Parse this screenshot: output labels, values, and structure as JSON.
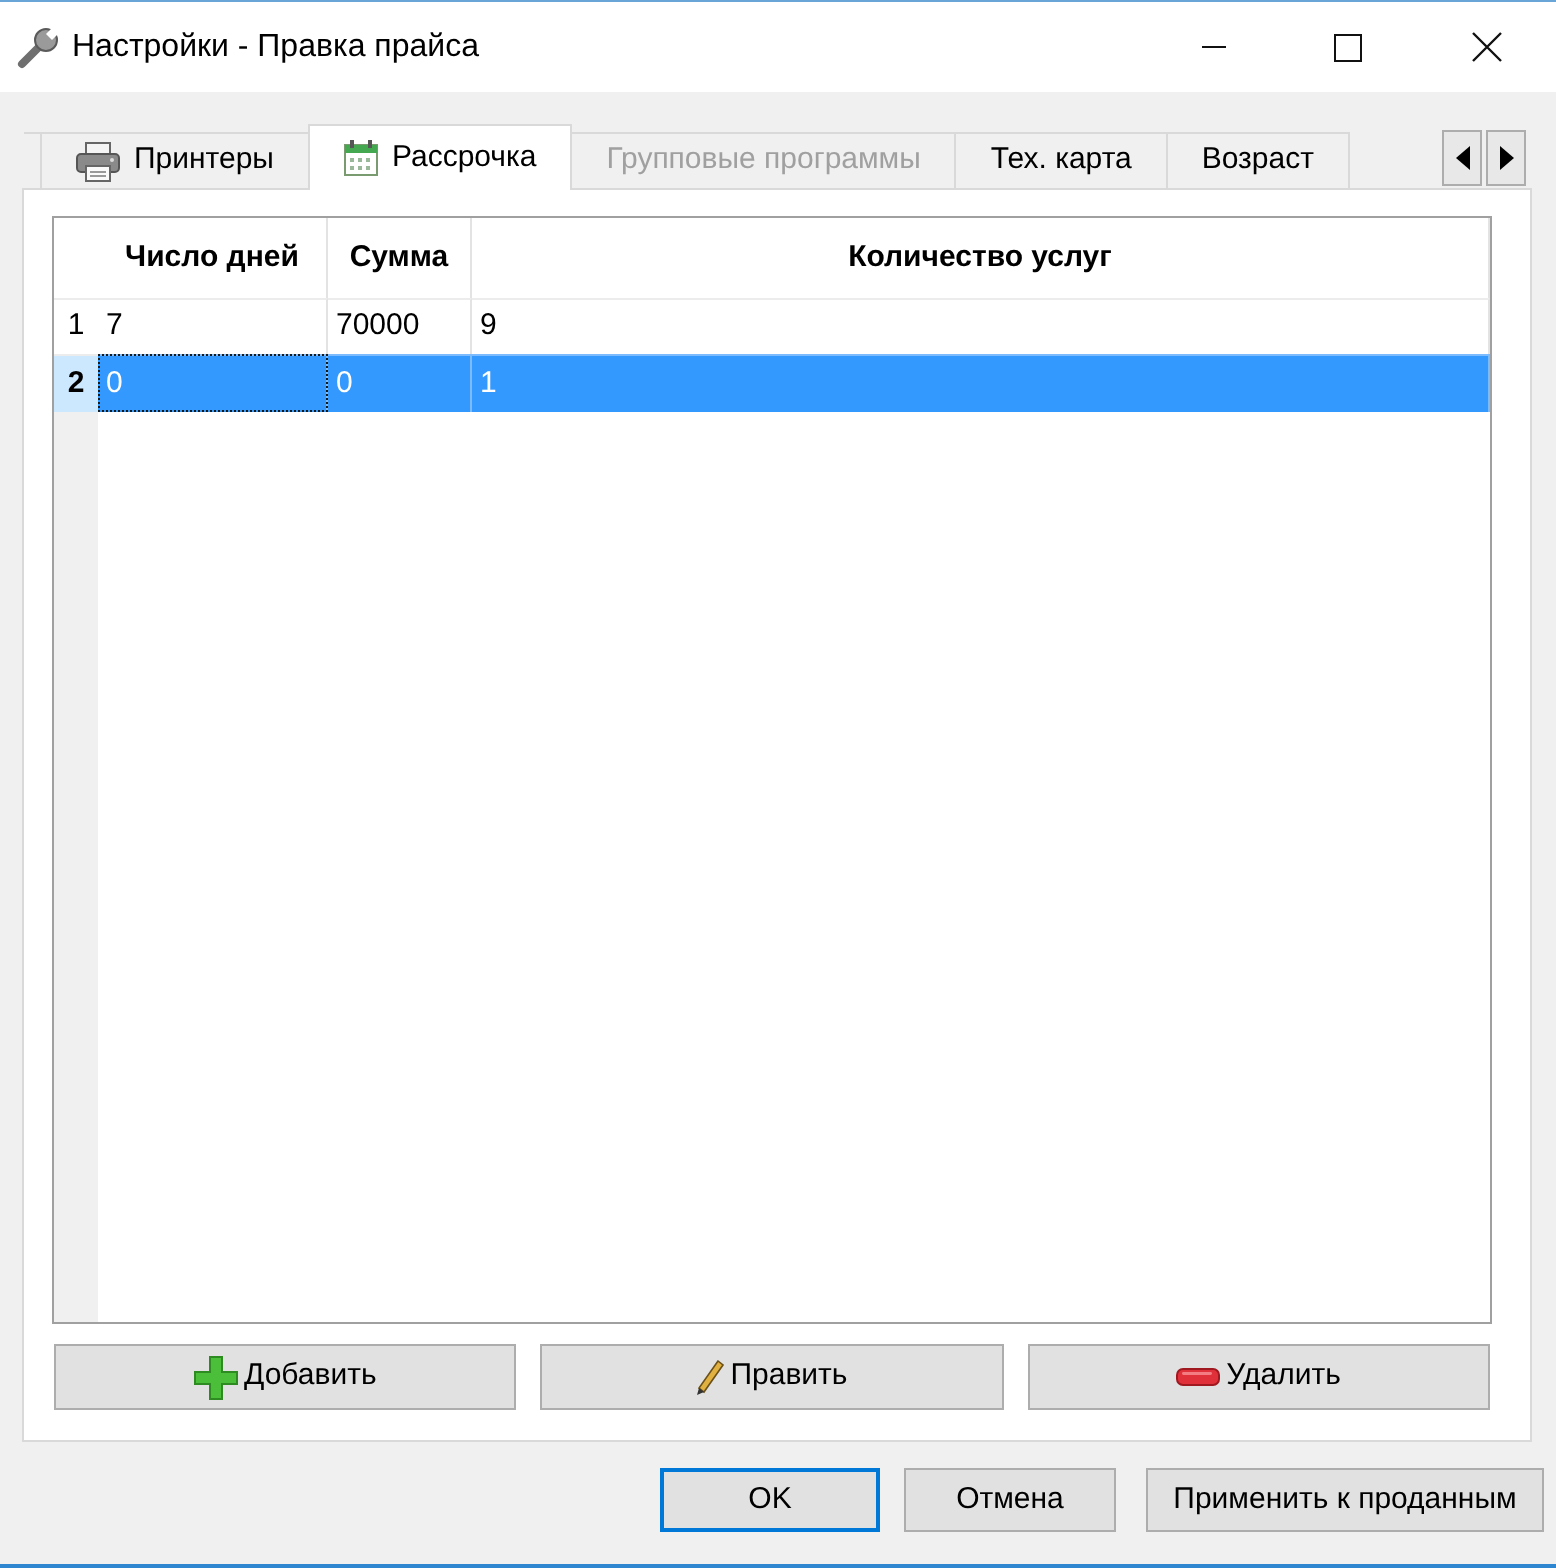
{
  "window": {
    "title": "Настройки - Правка прайса"
  },
  "tabs": [
    {
      "label": "Принтеры",
      "kind": "printer",
      "selected": false,
      "disabled": false
    },
    {
      "label": "Рассрочка",
      "kind": "calendar",
      "selected": true,
      "disabled": false
    },
    {
      "label": "Групповые программы",
      "kind": "plain",
      "selected": false,
      "disabled": true
    },
    {
      "label": "Тех. карта",
      "kind": "plain",
      "selected": false,
      "disabled": false
    },
    {
      "label": "Возраст",
      "kind": "plain",
      "selected": false,
      "disabled": false
    }
  ],
  "table": {
    "columns": [
      "Число дней",
      "Сумма",
      "Количество услуг"
    ],
    "rows": [
      {
        "number": "1",
        "selected": false,
        "cells": [
          {
            "text": "7",
            "focused": false
          },
          {
            "text": "70000",
            "focused": false
          },
          {
            "text": "9",
            "focused": false
          }
        ]
      },
      {
        "number": "2",
        "selected": true,
        "cells": [
          {
            "text": "0",
            "focused": true
          },
          {
            "text": "0",
            "focused": false
          },
          {
            "text": "1",
            "focused": false
          }
        ]
      }
    ]
  },
  "actions": [
    {
      "label": "Добавить",
      "kind": "add"
    },
    {
      "label": "Править",
      "kind": "edit"
    },
    {
      "label": "Удалить",
      "kind": "delete"
    }
  ],
  "dialog_buttons": [
    {
      "label": "OK",
      "default": true
    },
    {
      "label": "Отмена",
      "default": false
    },
    {
      "label": "Применить к проданным",
      "default": false
    }
  ]
}
